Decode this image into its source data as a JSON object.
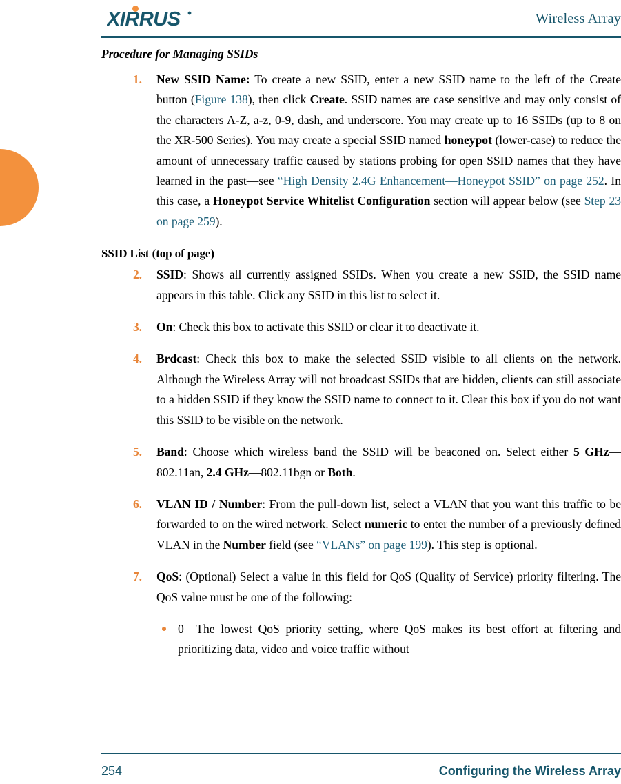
{
  "colors": {
    "brand_teal": "#17566B",
    "link_teal": "#1E6079",
    "accent_orange": "#E8863A",
    "tab_orange": "#F3913D"
  },
  "header": {
    "logo_text": "XIRRUS",
    "logo_trademark": "®",
    "title": "Wireless Array"
  },
  "content": {
    "section_heading": "Procedure for Managing SSIDs",
    "sub_heading": "SSID List (top of page)",
    "steps": [
      {
        "num": "1.",
        "term": "New SSID Name:",
        "parts": [
          {
            "t": "New SSID Name:",
            "s": "b"
          },
          {
            "t": " To create a new SSID, enter a new SSID name to the left of the Create button (",
            "s": "n"
          },
          {
            "t": "Figure 138",
            "s": "l"
          },
          {
            "t": "), then click ",
            "s": "n"
          },
          {
            "t": "Create",
            "s": "b"
          },
          {
            "t": ". SSID names are case sensitive and may only consist of the characters A-Z, a-z, 0-9, dash, and underscore. You may create up to 16 SSIDs (up to 8 on the XR-500 Series). You may create a special SSID named ",
            "s": "n"
          },
          {
            "t": "honeypot",
            "s": "b"
          },
          {
            "t": " (lower-case) to reduce the amount of unnecessary traffic caused by stations probing for open SSID names that they have learned in the past—see ",
            "s": "n"
          },
          {
            "t": "“High Density 2.4G Enhancement—Honeypot SSID” on page 252",
            "s": "l"
          },
          {
            "t": ". In this case, a ",
            "s": "n"
          },
          {
            "t": "Honeypot Service Whitelist Configuration",
            "s": "b"
          },
          {
            "t": " section will appear below (see ",
            "s": "n"
          },
          {
            "t": "Step 23 on page 259",
            "s": "l"
          },
          {
            "t": ").",
            "s": "n"
          }
        ]
      },
      {
        "num": "2.",
        "term": "SSID",
        "parts": [
          {
            "t": "SSID",
            "s": "b"
          },
          {
            "t": ": Shows all currently assigned SSIDs. When you create a new SSID, the SSID name appears in this table. Click any SSID in this list to select it.",
            "s": "n"
          }
        ]
      },
      {
        "num": "3.",
        "term": "On",
        "parts": [
          {
            "t": "On",
            "s": "b"
          },
          {
            "t": ": Check this box to activate this SSID or clear it to deactivate it.",
            "s": "n"
          }
        ]
      },
      {
        "num": "4.",
        "term": "Brdcast",
        "parts": [
          {
            "t": "Brdcast",
            "s": "b"
          },
          {
            "t": ": Check this box to make the selected SSID visible to all clients on the network. Although the Wireless Array will not broadcast SSIDs that are hidden, clients can still associate to a hidden SSID if they know the SSID name to connect to it. Clear this box if you do not want this SSID to be visible on the network.",
            "s": "n"
          }
        ]
      },
      {
        "num": "5.",
        "term": "Band",
        "parts": [
          {
            "t": "Band",
            "s": "b"
          },
          {
            "t": ": Choose which wireless band the SSID will be beaconed on. Select either ",
            "s": "n"
          },
          {
            "t": "5 GHz",
            "s": "b"
          },
          {
            "t": "—802.11an, ",
            "s": "n"
          },
          {
            "t": "2.4 GHz",
            "s": "b"
          },
          {
            "t": "—802.11bgn or ",
            "s": "n"
          },
          {
            "t": "Both",
            "s": "b"
          },
          {
            "t": ".",
            "s": "n"
          }
        ]
      },
      {
        "num": "6.",
        "term": "VLAN ID / Number",
        "parts": [
          {
            "t": "VLAN ID / Number",
            "s": "b"
          },
          {
            "t": ": From the pull-down list, select a VLAN that you want this traffic to be forwarded to on the wired network. Select ",
            "s": "n"
          },
          {
            "t": "numeric",
            "s": "b"
          },
          {
            "t": " to enter the number of a previously defined VLAN in the ",
            "s": "n"
          },
          {
            "t": "Number",
            "s": "b"
          },
          {
            "t": " field (see ",
            "s": "n"
          },
          {
            "t": "“VLANs” on page 199",
            "s": "l"
          },
          {
            "t": "). This step is optional.",
            "s": "n"
          }
        ]
      },
      {
        "num": "7.",
        "term": "QoS",
        "parts": [
          {
            "t": "QoS",
            "s": "b"
          },
          {
            "t": ": (Optional) Select a value in this field for QoS (Quality of Service) priority filtering. The QoS value must be one of the following:",
            "s": "n"
          }
        ]
      }
    ],
    "bullets": [
      {
        "parts": [
          {
            "t": "0—The lowest QoS priority setting, where QoS makes its best effort at filtering and prioritizing data, video and voice traffic without",
            "s": "n"
          }
        ]
      }
    ]
  },
  "footer": {
    "page_number": "254",
    "section_title": "Configuring the Wireless Array"
  }
}
